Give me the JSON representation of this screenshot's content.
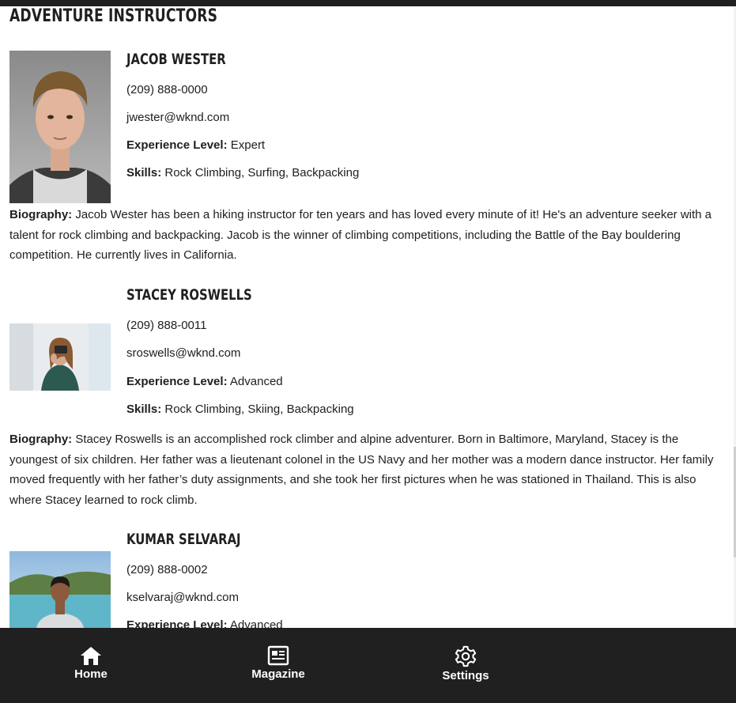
{
  "page": {
    "title": "ADVENTURE INSTRUCTORS"
  },
  "labels": {
    "experience": "Experience Level:",
    "skills": "Skills:",
    "biography": "Biography:"
  },
  "instructors": [
    {
      "name": "JACOB WESTER",
      "phone": "(209) 888-0000",
      "email": "jwester@wknd.com",
      "experience": "Expert",
      "skills": "Rock Climbing, Surfing, Backpacking",
      "biography": "Jacob Wester has been a hiking instructor for ten years and has loved every minute of it! He's an adventure seeker with a talent for rock climbing and backpacking. Jacob is the winner of climbing competitions, including the Battle of the Bay bouldering competition. He currently lives in California."
    },
    {
      "name": "STACEY ROSWELLS",
      "phone": "(209) 888-0011",
      "email": "sroswells@wknd.com",
      "experience": "Advanced",
      "skills": "Rock Climbing, Skiing, Backpacking",
      "biography": "Stacey Roswells is an accomplished rock climber and alpine adventurer. Born in Baltimore, Maryland, Stacey is the youngest of six children. Her father was a lieutenant colonel in the US Navy and her mother was a modern dance instructor. Her family moved frequently with her father’s duty assignments, and she took her first pictures when he was stationed in Thailand. This is also where Stacey learned to rock climb."
    },
    {
      "name": "KUMAR SELVARAJ",
      "phone": "(209) 888-0002",
      "email": "kselvaraj@wknd.com",
      "experience": "Advanced"
    }
  ],
  "nav": {
    "home": "Home",
    "magazine": "Magazine",
    "settings": "Settings"
  },
  "colors": {
    "nav_bg": "#202020",
    "text": "#202020"
  },
  "icons": {
    "home": "home-icon",
    "magazine": "newspaper-icon",
    "settings": "gear-icon"
  }
}
